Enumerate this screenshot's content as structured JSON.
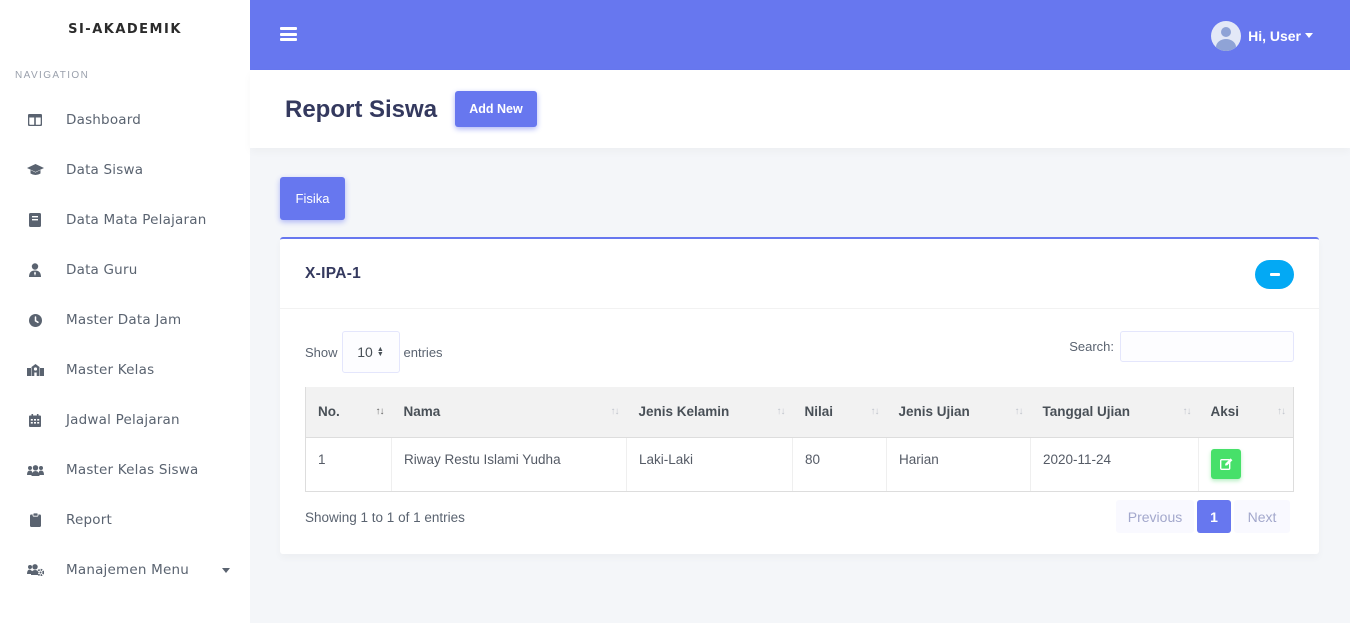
{
  "app": {
    "brand": "SI-AKADEMIK"
  },
  "sidebar": {
    "header": "NAVIGATION",
    "items": [
      {
        "label": "Dashboard",
        "icon": "columns-icon"
      },
      {
        "label": "Data Siswa",
        "icon": "graduation-cap-icon"
      },
      {
        "label": "Data Mata Pelajaran",
        "icon": "book-icon"
      },
      {
        "label": "Data Guru",
        "icon": "user-tie-icon"
      },
      {
        "label": "Master Data Jam",
        "icon": "clock-icon"
      },
      {
        "label": "Master Kelas",
        "icon": "school-icon"
      },
      {
        "label": "Jadwal Pelajaran",
        "icon": "calendar-icon"
      },
      {
        "label": "Master Kelas Siswa",
        "icon": "users-icon"
      },
      {
        "label": "Report",
        "icon": "clipboard-icon"
      },
      {
        "label": "Manajemen Menu",
        "icon": "users-cog-icon"
      }
    ]
  },
  "topbar": {
    "user_label": "Hi, User"
  },
  "page": {
    "title": "Report Siswa",
    "add_button": "Add New"
  },
  "tabs": [
    {
      "label": "Fisika"
    }
  ],
  "card": {
    "title": "X-IPA-1",
    "show_label": "Show",
    "entries_value": "10",
    "entries_label": "entries",
    "search_label": "Search:",
    "search_value": ""
  },
  "table": {
    "columns": [
      "No.",
      "Nama",
      "Jenis Kelamin",
      "Nilai",
      "Jenis Ujian",
      "Tanggal Ujian",
      "Aksi"
    ],
    "rows": [
      {
        "no": "1",
        "nama": "Riway Restu Islami Yudha",
        "jenis_kelamin": "Laki-Laki",
        "nilai": "80",
        "jenis_ujian": "Harian",
        "tanggal_ujian": "2020-11-24"
      }
    ]
  },
  "footer": {
    "info": "Showing 1 to 1 of 1 entries",
    "previous": "Previous",
    "current_page": "1",
    "next": "Next"
  },
  "colors": {
    "primary": "#6777ef",
    "info": "#03a9f4",
    "success": "#47e06a"
  }
}
